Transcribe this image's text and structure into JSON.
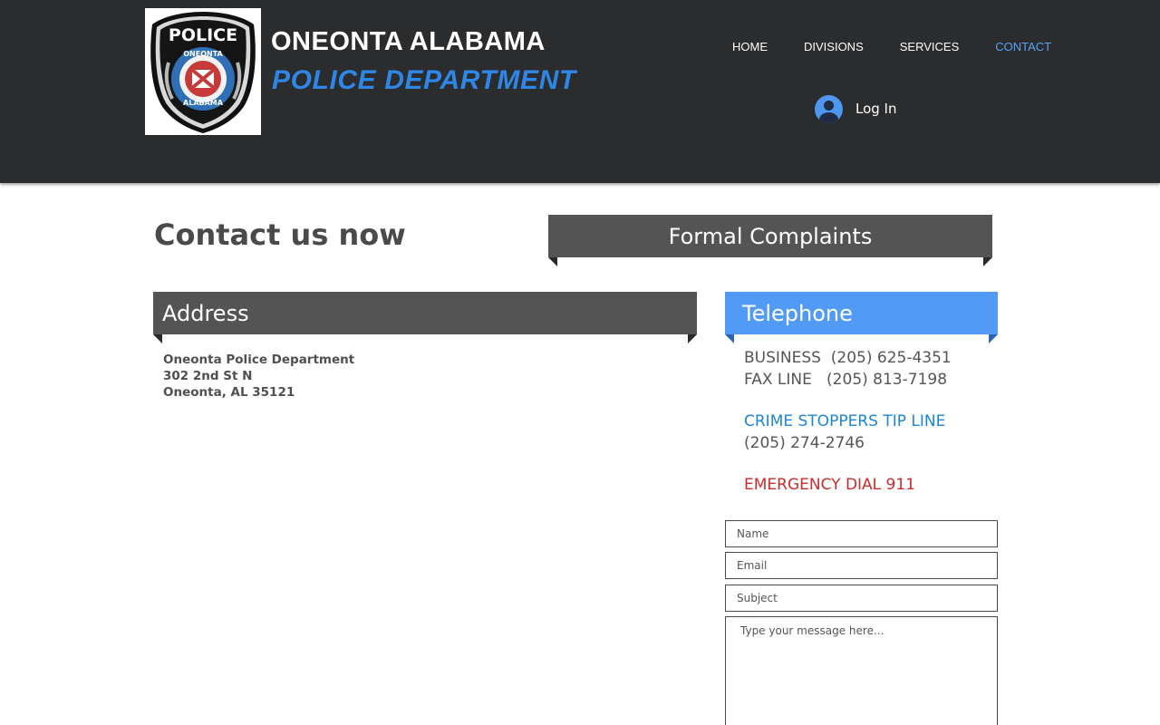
{
  "header": {
    "title_line1": "ONEONTA ALABAMA",
    "title_line2": "POLICE DEPARTMENT",
    "logo": {
      "top_text": "POLICE",
      "ring_top": "ONEONTA",
      "ring_bottom": "ALABAMA"
    },
    "nav": [
      {
        "label": "HOME",
        "active": false
      },
      {
        "label": "DIVISIONS",
        "active": false
      },
      {
        "label": "SERVICES",
        "active": false
      },
      {
        "label": "CONTACT",
        "active": true
      }
    ],
    "login_label": "Log In",
    "login_icon": "user-avatar-icon"
  },
  "main": {
    "contact_title": "Contact us now",
    "complaints_label": "Formal Complaints",
    "address": {
      "heading": "Address",
      "lines": [
        "Oneonta Police Department",
        "302 2nd St N",
        "Oneonta, AL 35121"
      ]
    },
    "telephone": {
      "heading": "Telephone",
      "business": "BUSINESS  (205) 625-4351",
      "fax": "FAX LINE   (205) 813-7198",
      "crime_label": "CRIME STOPPERS TIP LINE",
      "crime_number": "(205) 274-2746",
      "emergency": "EMERGENCY DIAL 911"
    }
  },
  "form": {
    "name_placeholder": "Name",
    "email_placeholder": "Email",
    "subject_placeholder": "Subject",
    "message_placeholder": "Type your message here..."
  },
  "colors": {
    "header_bg": "#2b2c2e",
    "accent_blue": "#2e86e6",
    "ribbon_gray": "#545454",
    "ribbon_blue": "#519bf7",
    "emergency_red": "#cc2b2b"
  }
}
